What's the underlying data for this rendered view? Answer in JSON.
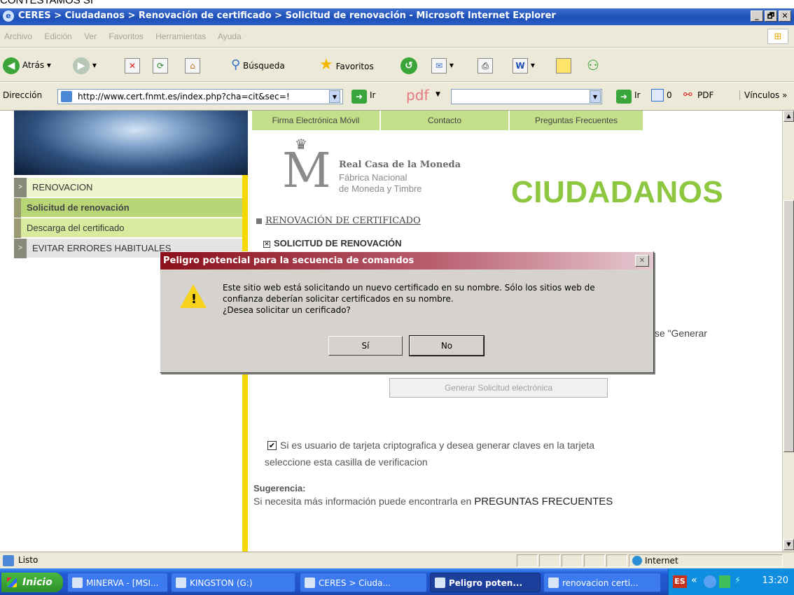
{
  "caption": "CONTESTAMOS SI",
  "window": {
    "title": "CERES > Ciudadanos > Renovación de certificado > Solicitud de renovación - Microsoft Internet Explorer",
    "buttons": [
      "_",
      "🗗",
      "✕"
    ]
  },
  "menu": [
    "Archivo",
    "Edición",
    "Ver",
    "Favoritos",
    "Herramientas",
    "Ayuda"
  ],
  "toolbar": {
    "back": "Atrás",
    "search": "Búsqueda",
    "favorites": "Favoritos"
  },
  "address": {
    "label": "Dirección",
    "url": "http://www.cert.fnmt.es/index.php?cha=cit&sec=!",
    "go": "Ir",
    "pdf_logo": "pdf",
    "go2": "Ir",
    "count": "0",
    "pdf_button": "PDF",
    "links": "Vínculos"
  },
  "site": {
    "nav": [
      "Firma Electrónica Móvil",
      "Contacto",
      "Preguntas Frecuentes"
    ],
    "left_menu": [
      {
        "label": "RENOVACION",
        "marker": ">"
      },
      {
        "label": "Solicitud de renovación",
        "marker": ""
      },
      {
        "label": "Descarga del certificado",
        "marker": ""
      },
      {
        "label": "EVITAR ERRORES HABITUALES",
        "marker": ">"
      }
    ],
    "logo": {
      "line1": "Real Casa de la Moneda",
      "line2": "Fábrica Nacional",
      "line3": "de Moneda y Timbre"
    },
    "heading": "CIUDADANOS",
    "section": "RENOVACIÓN DE CERTIFICADO",
    "subsection": "SOLICITUD DE RENOVACIÓN",
    "pulse_fragment": "ulse \"Generar",
    "generate_button": "Generar Solicitud electrónica",
    "card_check": {
      "checked": true,
      "line1": "Si es usuario de tarjeta criptografica y desea generar claves en la tarjeta",
      "line2": "seleccione esta casilla de verificacion"
    },
    "suggestion": {
      "title": "Sugerencia:",
      "text": "Si necesita más información puede encontrarla en",
      "link": "PREGUNTAS FRECUENTES"
    }
  },
  "dialog": {
    "title": "Peligro potencial para la secuencia de comandos",
    "line1": "Este sitio web está solicitando un nuevo certificado en su nombre. Sólo los sitios web de",
    "line2": "confianza deberían solicitar certificados en su nombre.",
    "line3": "¿Desea solicitar un cerificado?",
    "yes": "Sí",
    "no": "No"
  },
  "status": {
    "text": "Listo",
    "zone": "Internet"
  },
  "taskbar": {
    "start": "Inicio",
    "tasks": [
      "MINERVA - [MSI...",
      "KINGSTON (G:)",
      "CERES > Ciuda...",
      "Peligro poten...",
      "renovacion certi..."
    ],
    "lang": "ES",
    "clock": "13:20"
  }
}
